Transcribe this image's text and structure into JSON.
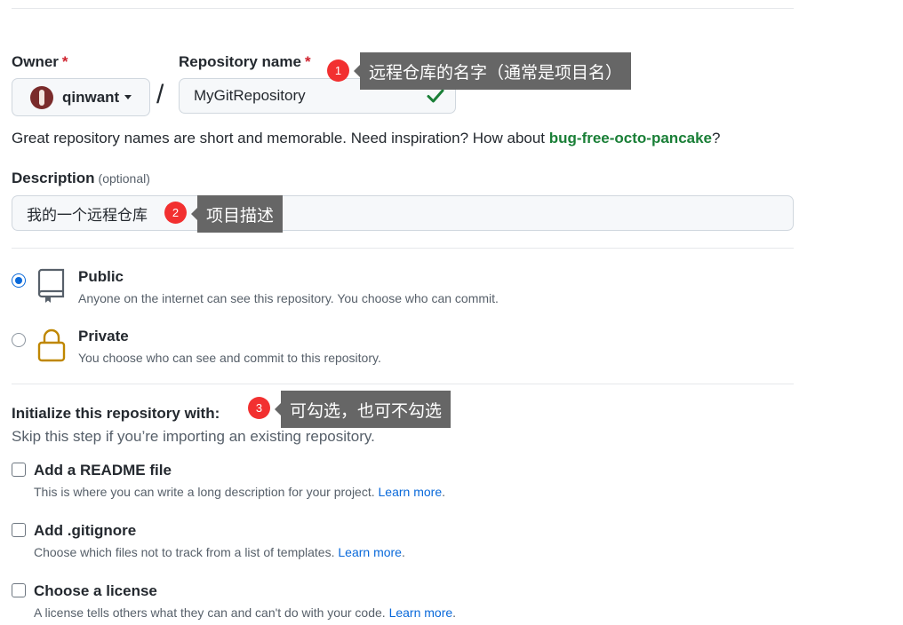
{
  "owner": {
    "label": "Owner",
    "required_mark": "*",
    "value": "qinwant"
  },
  "repository": {
    "label": "Repository name",
    "required_mark": "*",
    "value": "MyGitRepository",
    "valid_icon": "check-icon"
  },
  "separator": "/",
  "help": {
    "text": "Great repository names are short and memorable. Need inspiration? How about ",
    "suggestion": "bug-free-octo-pancake",
    "suffix": "?"
  },
  "description": {
    "label": "Description",
    "optional": "(optional)",
    "value": "我的一个远程仓库"
  },
  "visibility": [
    {
      "title": "Public",
      "desc": "Anyone on the internet can see this repository. You choose who can commit.",
      "icon": "repo-icon",
      "selected": true
    },
    {
      "title": "Private",
      "desc": "You choose who can see and commit to this repository.",
      "icon": "lock-icon",
      "selected": false
    }
  ],
  "init": {
    "title": "Initialize this repository with:",
    "subtitle": "Skip this step if you’re importing an existing repository.",
    "options": [
      {
        "title": "Add a README file",
        "desc": "This is where you can write a long description for your project.",
        "link": "Learn more",
        "end": ".",
        "checked": false
      },
      {
        "title": "Add .gitignore",
        "desc": "Choose which files not to track from a list of templates.",
        "link": "Learn more",
        "end": ".",
        "checked": false
      },
      {
        "title": "Choose a license",
        "desc": "A license tells others what they can and can't do with your code.",
        "link": "Learn more",
        "end": ".",
        "checked": false
      }
    ]
  },
  "annotations": [
    {
      "num": "1",
      "text": "远程仓库的名字（通常是项目名）"
    },
    {
      "num": "2",
      "text": "项目描述"
    },
    {
      "num": "3",
      "text": "可勾选，也可不勾选"
    }
  ],
  "colors": {
    "accent": "#0969da",
    "success": "#1a7f37",
    "required": "#cf222e",
    "annotation_badge": "#f23030",
    "annotation_tip": "#666666",
    "lock": "#bf8700"
  }
}
